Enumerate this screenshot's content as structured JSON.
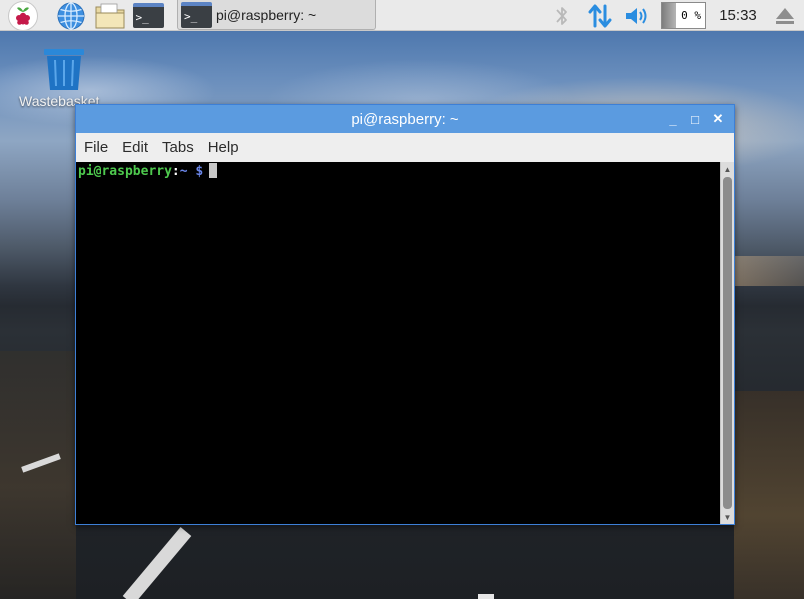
{
  "panel": {
    "taskbar_window_label": "pi@raspberry: ~",
    "launcher_terminal_glyph": ">_",
    "taskbar_terminal_glyph": ">_",
    "cpu_usage": "0 %",
    "clock": "15:33",
    "icons": [
      "raspberry-menu-icon",
      "web-browser-icon",
      "file-manager-icon",
      "terminal-icon",
      "bluetooth-icon",
      "network-icon",
      "volume-icon",
      "eject-icon"
    ]
  },
  "desktop": {
    "wastebasket_label": "Wastebasket"
  },
  "window": {
    "title": "pi@raspberry: ~",
    "minimize_glyph": "_",
    "maximize_glyph": "□",
    "close_glyph": "✕",
    "menu": [
      {
        "label": "File"
      },
      {
        "label": "Edit"
      },
      {
        "label": "Tabs"
      },
      {
        "label": "Help"
      }
    ],
    "prompt": {
      "user_host": "pi@raspberry",
      "separator": ":",
      "path": "~",
      "symbol": " $"
    }
  },
  "colors": {
    "titlebar": "#5b9be0",
    "prompt_user": "#4ec94e",
    "prompt_path": "#6b86e8",
    "panel_accent_blue": "#2a8de0"
  }
}
